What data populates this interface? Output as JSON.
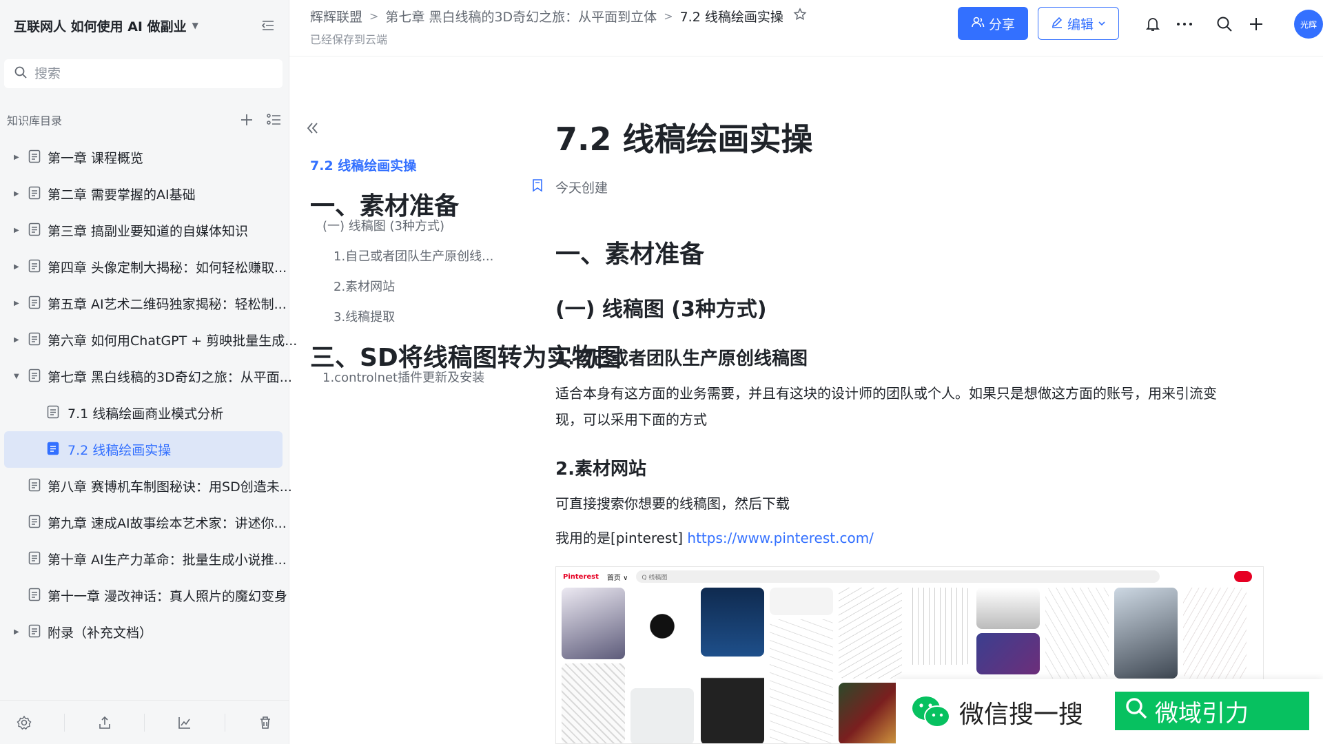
{
  "sidebar": {
    "kb_title": "互联网人 如何使用 AI 做副业",
    "search_placeholder": "搜索",
    "toc_label": "知识库目录",
    "items": [
      {
        "label": "第一章 课程概览"
      },
      {
        "label": "第二章 需要掌握的AI基础"
      },
      {
        "label": "第三章 搞副业要知道的自媒体知识"
      },
      {
        "label": "第四章 头像定制大揭秘：如何轻松赚取..."
      },
      {
        "label": "第五章 AI艺术二维码独家揭秘：轻松制..."
      },
      {
        "label": "第六章 如何用ChatGPT + 剪映批量生成..."
      },
      {
        "label": "第七章 黑白线稿的3D奇幻之旅：从平面..."
      },
      {
        "label": "7.1 线稿绘画商业模式分析"
      },
      {
        "label": "7.2 线稿绘画实操"
      },
      {
        "label": "第八章 赛博机车制图秘诀：用SD创造未..."
      },
      {
        "label": "第九章 速成AI故事绘本艺术家：讲述你..."
      },
      {
        "label": "第十章 AI生产力革命：批量生成小说推..."
      },
      {
        "label": "第十一章 漫改神话：真人照片的魔幻变身"
      },
      {
        "label": "附录（补充文档）"
      }
    ]
  },
  "topbar": {
    "breadcrumb": [
      "辉辉联盟",
      "第七章 黑白线稿的3D奇幻之旅：从平面到立体",
      "7.2 线稿绘画实操"
    ],
    "saved_status": "已经保存到云端",
    "share_label": "分享",
    "edit_label": "编辑",
    "avatar_text": "光辉"
  },
  "outline": {
    "items": [
      {
        "label": "7.2 线稿绘画实操"
      },
      {
        "label": "一、素材准备"
      },
      {
        "label": "(一) 线稿图 (3种方式)"
      },
      {
        "label": "1.自己或者团队生产原创线..."
      },
      {
        "label": "2.素材网站"
      },
      {
        "label": "3.线稿提取"
      },
      {
        "label": "三、SD将线稿图转为实物图"
      },
      {
        "label": "1.controlnet插件更新及安装"
      }
    ]
  },
  "doc": {
    "title": "7.2 线稿绘画实操",
    "created": "今天创建",
    "h1": "一、素材准备",
    "h2": "(一) 线稿图 (3种方式)",
    "h3_1": "1.自己或者团队生产原创线稿图",
    "p1": "适合本身有这方面的业务需要，并且有这块的设计师的团队或个人。如果只是想做这方面的账号，用来引流变现，可以采用下面的方式",
    "h3_2": "2.素材网站",
    "p2": "可直接搜索你想要的线稿图，然后下载",
    "p3_prefix": "我用的是[pinterest] ",
    "p3_link": "https://www.pinterest.com/"
  },
  "pinterest": {
    "logo": "Pinterest",
    "tab": "首页 ∨",
    "search": "Q 线稿图"
  },
  "overlay": {
    "wechat_text": "微信搜一搜",
    "search_text": "微域引力"
  }
}
